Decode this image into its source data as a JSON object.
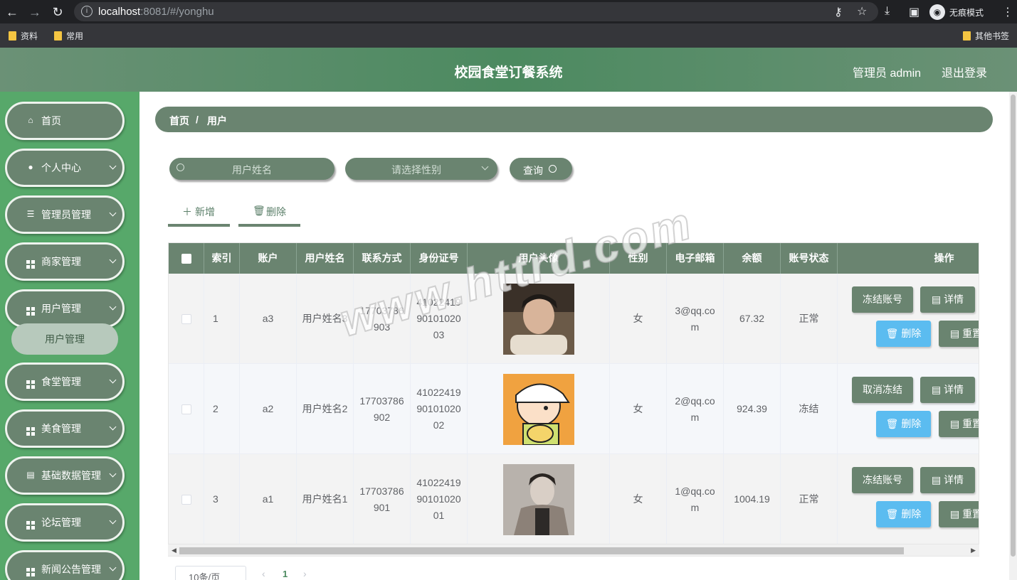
{
  "browser": {
    "url_host": "localhost",
    "url_rest": ":8081/#/yonghu",
    "incognito_label": "无痕模式",
    "bookmarks": [
      "资料",
      "常用"
    ],
    "other_bookmarks": "其他书签"
  },
  "header": {
    "title": "校园食堂订餐系统",
    "user": "管理员 admin",
    "logout": "退出登录"
  },
  "sidebar": {
    "items": [
      {
        "label": "首页",
        "icon": "home-icon"
      },
      {
        "label": "个人中心",
        "icon": "user-icon"
      },
      {
        "label": "管理员管理",
        "icon": "list-icon"
      },
      {
        "label": "商家管理",
        "icon": "grid-icon"
      },
      {
        "label": "用户管理",
        "icon": "grid-icon"
      },
      {
        "label": "食堂管理",
        "icon": "grid-icon"
      },
      {
        "label": "美食管理",
        "icon": "grid-icon"
      },
      {
        "label": "基础数据管理",
        "icon": "clipboard-icon"
      },
      {
        "label": "论坛管理",
        "icon": "grid-icon"
      },
      {
        "label": "新闻公告管理",
        "icon": "grid-icon"
      }
    ],
    "sub_item": "用户管理"
  },
  "breadcrumb": {
    "home": "首页",
    "sep": "/",
    "current": "用户"
  },
  "search": {
    "name_placeholder": "用户姓名",
    "gender_placeholder": "请选择性别",
    "query_label": "查询"
  },
  "actions": {
    "add": "新增",
    "delete": "删除"
  },
  "table": {
    "columns": [
      "索引",
      "账户",
      "用户姓名",
      "联系方式",
      "身份证号",
      "用户头像",
      "性别",
      "电子邮箱",
      "余额",
      "账号状态",
      "操作"
    ],
    "rows": [
      {
        "index": "1",
        "account": "a3",
        "name": "用户姓名3",
        "phone": "17703786903",
        "id_card": "410224199010102003",
        "gender": "女",
        "email": "3@qq.com",
        "balance": "67.32",
        "status": "正常",
        "freeze_label": "冻结账号"
      },
      {
        "index": "2",
        "account": "a2",
        "name": "用户姓名2",
        "phone": "17703786902",
        "id_card": "410224199010102002",
        "gender": "女",
        "email": "2@qq.com",
        "balance": "924.39",
        "status": "冻结",
        "freeze_label": "取消冻结"
      },
      {
        "index": "3",
        "account": "a1",
        "name": "用户姓名1",
        "phone": "17703786901",
        "id_card": "410224199010102001",
        "gender": "女",
        "email": "1@qq.com",
        "balance": "1004.19",
        "status": "正常",
        "freeze_label": "冻结账号"
      }
    ],
    "op_detail": "详情",
    "op_delete": "删除",
    "op_reset": "重置"
  },
  "pager": {
    "size_label": "10条/页",
    "current": "1"
  },
  "watermark": "www.httrd.com",
  "colors": {
    "primary": "#6a8470",
    "sidebar": "#57a86a",
    "blue": "#5bbcf0"
  }
}
